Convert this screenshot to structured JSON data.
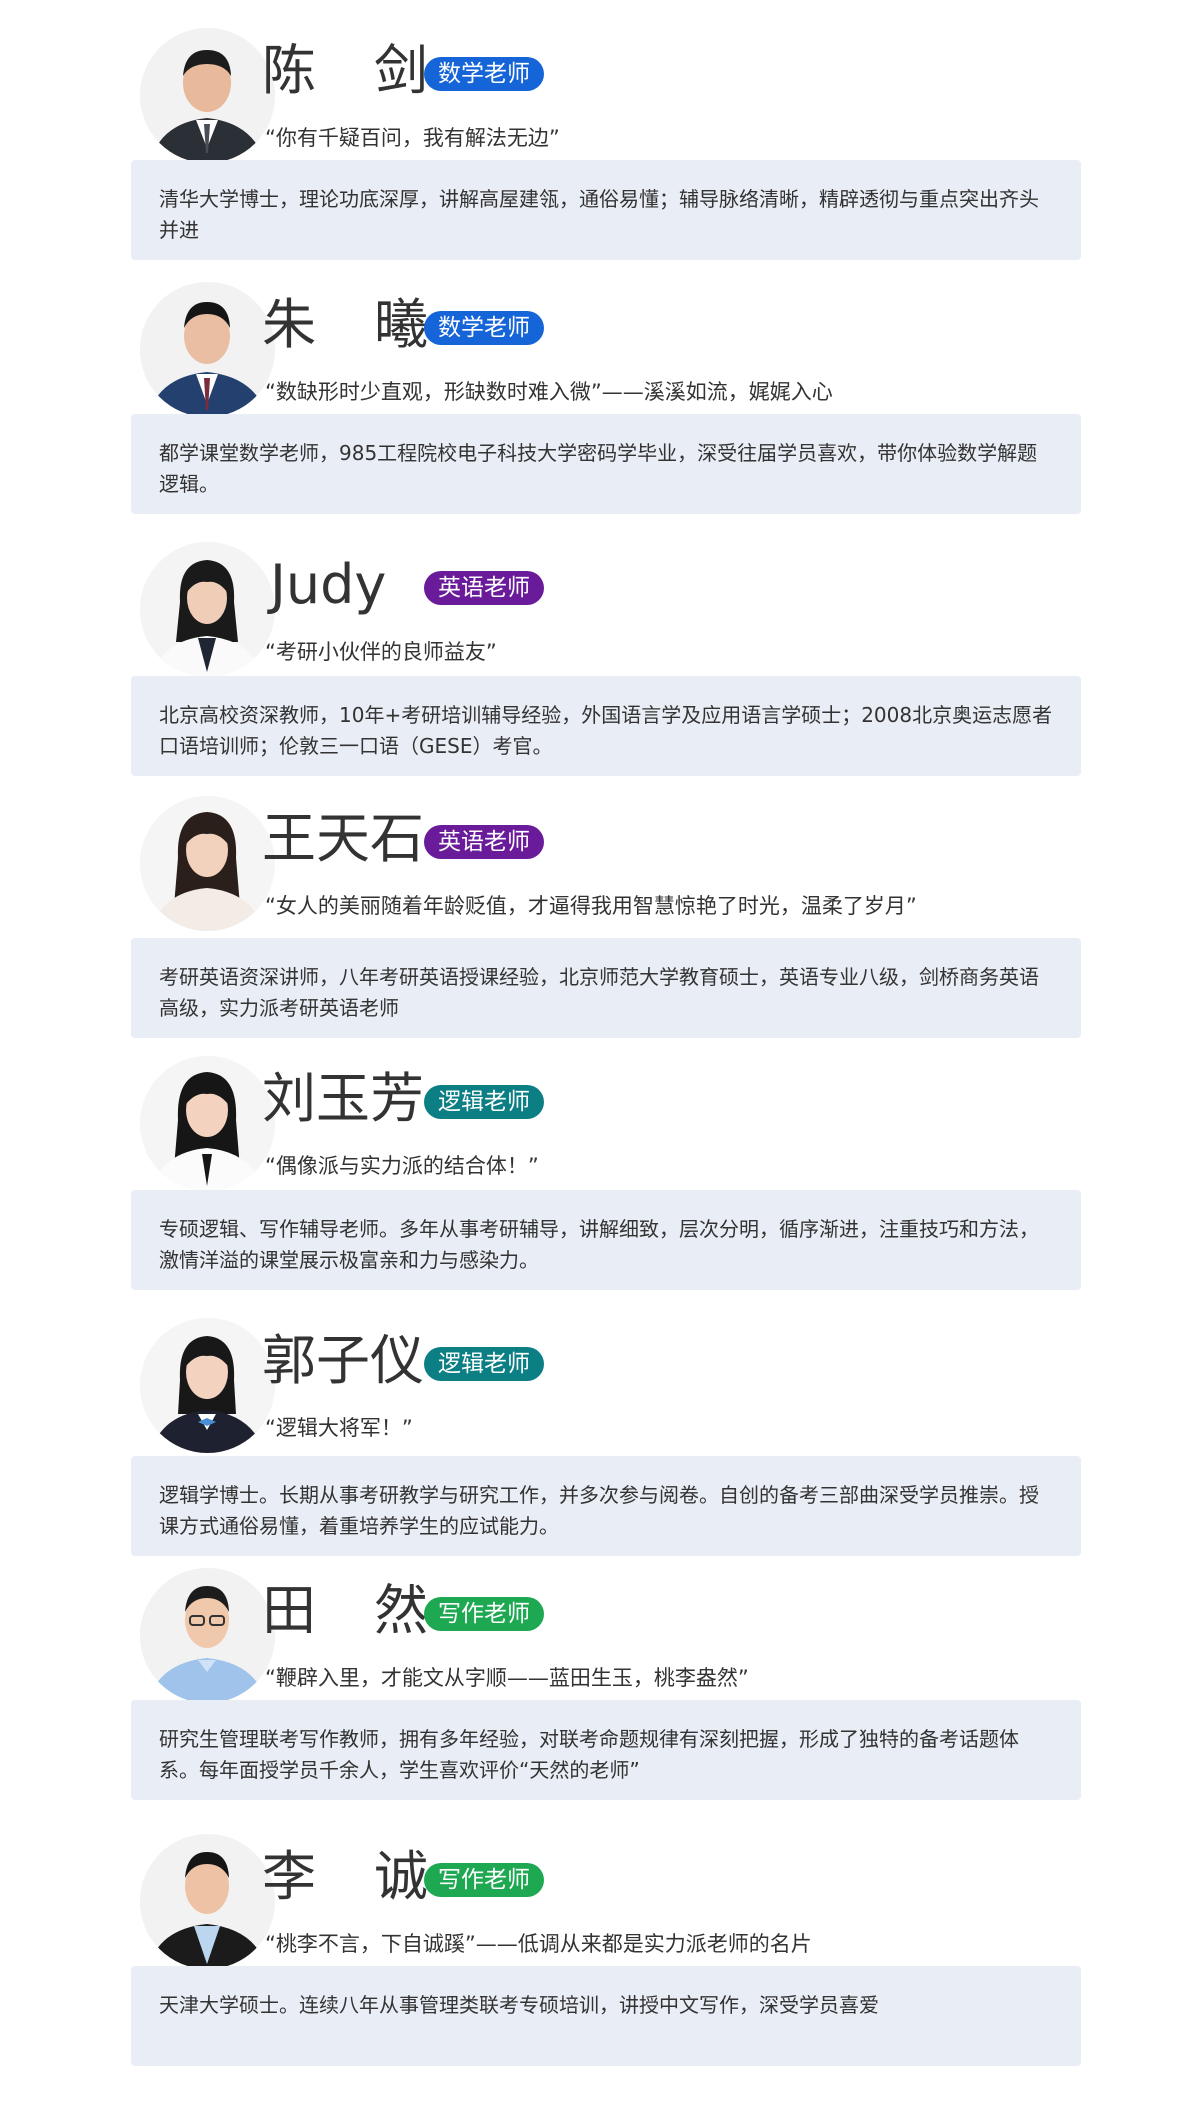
{
  "colors": {
    "badge_math": "#1565d8",
    "badge_english": "#6a1b9a",
    "badge_logic": "#0b7f84",
    "badge_writing": "#1ea852",
    "intro_bg": "#e9edf5"
  },
  "teachers": [
    {
      "name": "陈　剑",
      "badge": "数学老师",
      "badge_color": "#1565d8",
      "quote": "“你有千疑百问，我有解法无边”",
      "intro": "清华大学博士，理论功底深厚，讲解高屋建瓴，通俗易懂；辅导脉络清晰，精辟透彻与重点突出齐头并进",
      "avatar_icon": "male-teacher-avatar"
    },
    {
      "name": "朱　曦",
      "badge": "数学老师",
      "badge_color": "#1565d8",
      "quote": "“数缺形时少直观，形缺数时难入微”——溪溪如流，娓娓入心",
      "intro": "都学课堂数学老师，985工程院校电子科技大学密码学毕业，深受往届学员喜欢，带你体验数学解题逻辑。",
      "avatar_icon": "male-teacher-avatar"
    },
    {
      "name": "Judy",
      "badge": "英语老师",
      "badge_color": "#6a1b9a",
      "quote": "“考研小伙伴的良师益友”",
      "intro": "北京高校资深教师，10年+考研培训辅导经验，外国语言学及应用语言学硕士；2008北京奥运志愿者口语培训师；伦敦三一口语（GESE）考官。",
      "avatar_icon": "female-teacher-avatar"
    },
    {
      "name": "王天石",
      "badge": "英语老师",
      "badge_color": "#6a1b9a",
      "quote": "“女人的美丽随着年龄贬值，才逼得我用智慧惊艳了时光，温柔了岁月”",
      "intro": "考研英语资深讲师，八年考研英语授课经验，北京师范大学教育硕士，英语专业八级，剑桥商务英语高级，实力派考研英语老师",
      "avatar_icon": "female-teacher-avatar"
    },
    {
      "name": "刘玉芳",
      "badge": "逻辑老师",
      "badge_color": "#0b7f84",
      "quote": "“偶像派与实力派的结合体！”",
      "intro": "专硕逻辑、写作辅导老师。多年从事考研辅导，讲解细致，层次分明，循序渐进，注重技巧和方法，激情洋溢的课堂展示极富亲和力与感染力。",
      "avatar_icon": "female-teacher-avatar"
    },
    {
      "name": "郭子仪",
      "badge": "逻辑老师",
      "badge_color": "#0b7f84",
      "quote": "“逻辑大将军！”",
      "intro": "逻辑学博士。长期从事考研教学与研究工作，并多次参与阅卷。自创的备考三部曲深受学员推崇。授课方式通俗易懂，着重培养学生的应试能力。",
      "avatar_icon": "female-teacher-avatar"
    },
    {
      "name": "田　然",
      "badge": "写作老师",
      "badge_color": "#1ea852",
      "quote": "“鞭辟入里，才能文从字顺——蓝田生玉，桃李盎然”",
      "intro": "研究生管理联考写作教师，拥有多年经验，对联考命题规律有深刻把握，形成了独特的备考话题体系。每年面授学员千余人，学生喜欢评价“天然的老师”",
      "avatar_icon": "male-teacher-avatar"
    },
    {
      "name": "李　诚",
      "badge": "写作老师",
      "badge_color": "#1ea852",
      "quote": "“桃李不言，下自诚蹊”——低调从来都是实力派老师的名片",
      "intro": "天津大学硕士。连续八年从事管理类联考专硕培训，讲授中文写作，深受学员喜爱",
      "avatar_icon": "male-teacher-avatar"
    }
  ]
}
